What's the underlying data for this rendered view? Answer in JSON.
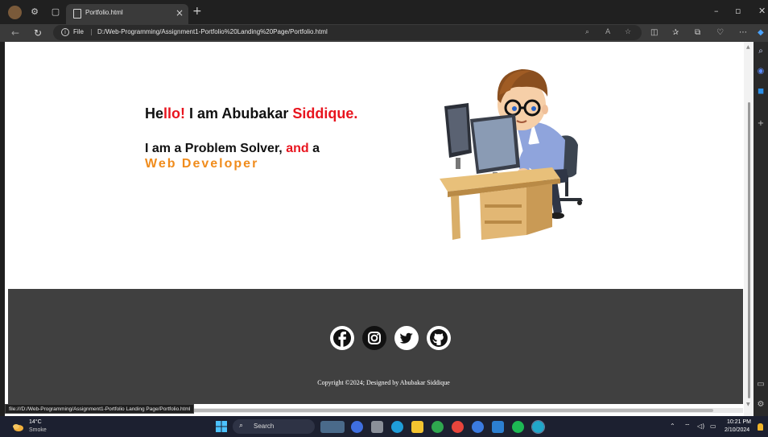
{
  "browser": {
    "tab_title": "Portfolio.html",
    "tab_close": "×",
    "new_tab": "+",
    "url_scheme": "File",
    "url_separator": "|",
    "url": "D:/Web-Programming/Assignment1-Portfolio%20Landing%20Page/Portfolio.html",
    "status_url": "file:///D:/Web-Programming/Assignment1-Portfolio Landing Page/Portfolio.html"
  },
  "hero": {
    "hello_prefix": "He",
    "hello_red": "llo!",
    "hello_mid": " I am Abubakar ",
    "hello_name": "Siddique.",
    "tagline_prefix": "I am a Problem Solver, ",
    "tagline_red": "and",
    "tagline_suffix": " a",
    "role": "Web Developer"
  },
  "footer": {
    "social": [
      "facebook-icon",
      "instagram-icon",
      "twitter-icon",
      "github-icon"
    ],
    "copyright": "Copyright ©2024; Designed by Abubakar Siddique"
  },
  "taskbar": {
    "temperature": "14°C",
    "condition": "Smoke",
    "search_label": "Search",
    "time": "10:21 PM",
    "date": "2/10/2024"
  },
  "colors": {
    "accent_red": "#e8141e",
    "accent_orange": "#f08c1c",
    "footer_bg": "#404040"
  }
}
